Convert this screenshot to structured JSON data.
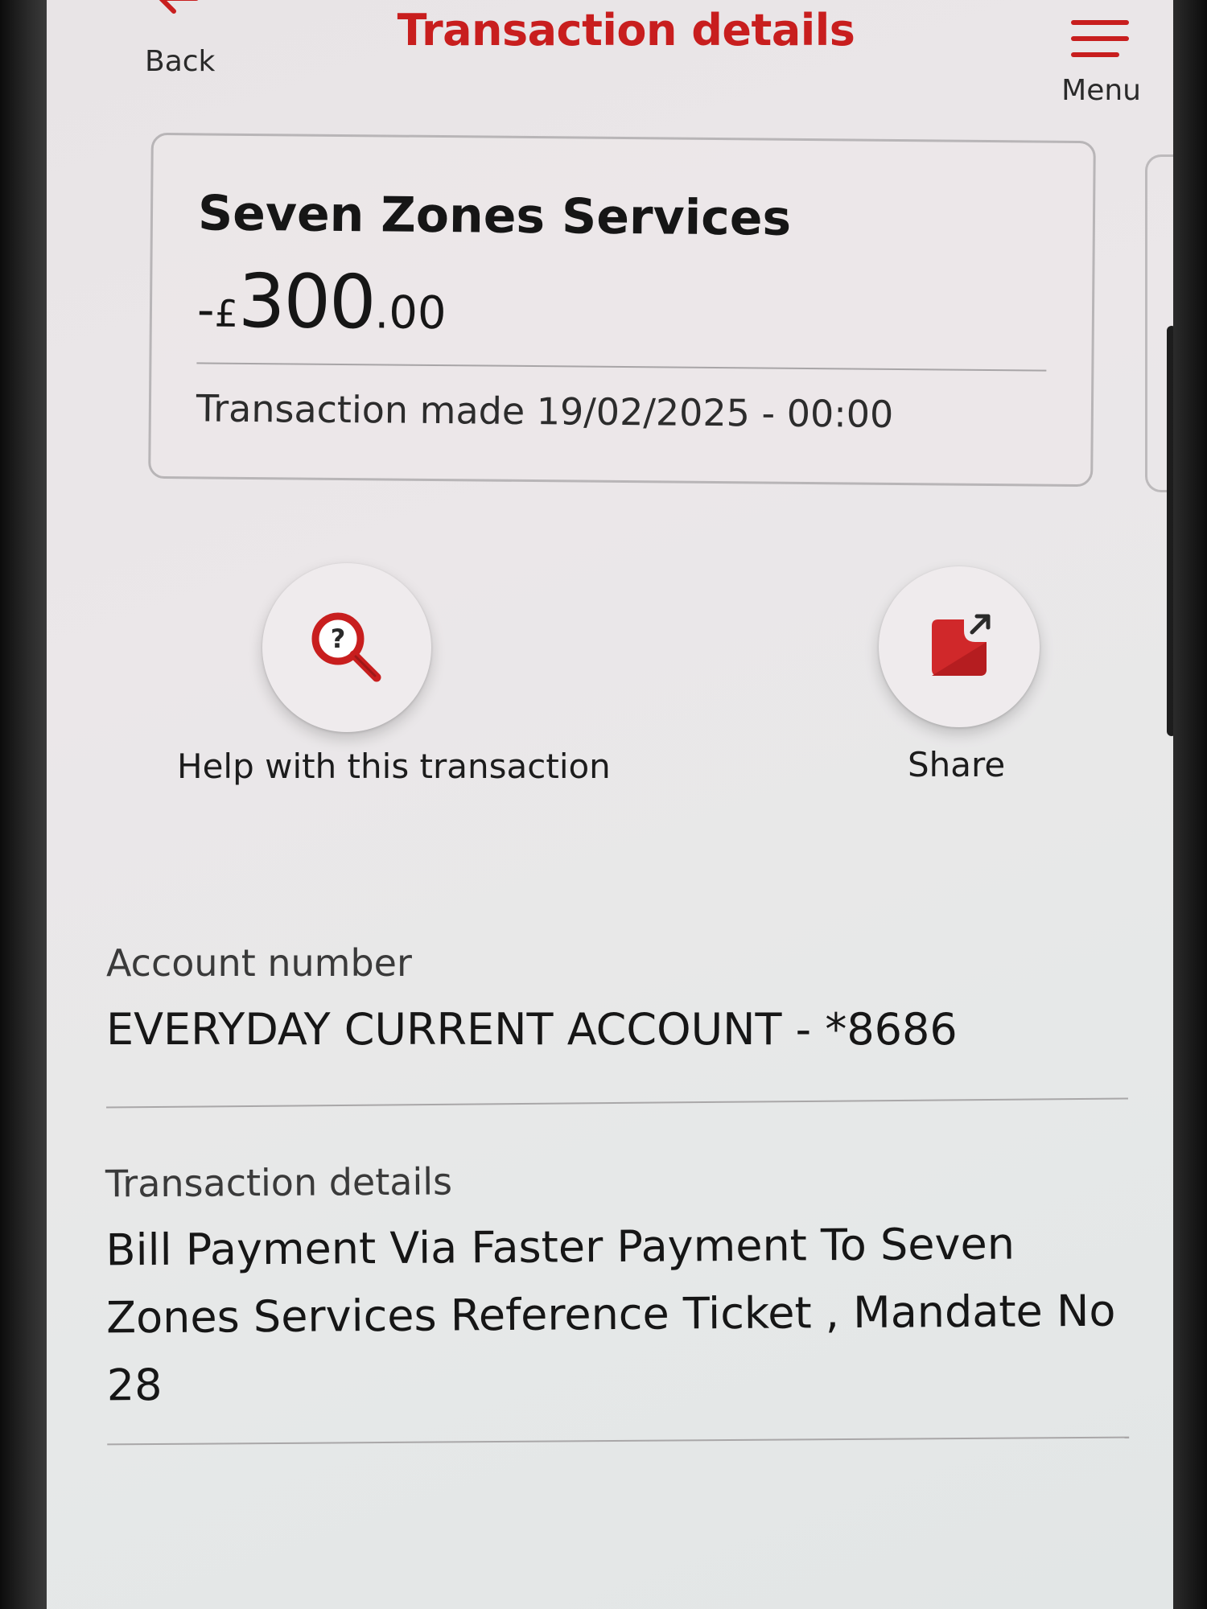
{
  "header": {
    "back_label": "Back",
    "title": "Transaction details",
    "menu_label": "Menu"
  },
  "summary": {
    "payee": "Seven Zones Services",
    "amount": {
      "sign": "-",
      "currency": "£",
      "whole": "300",
      "decimal": ".00"
    },
    "date_text": "Transaction made 19/02/2025 - 00:00"
  },
  "actions": [
    {
      "label": "Help with this transaction",
      "icon": "magnifier-question-icon"
    },
    {
      "label": "Share",
      "icon": "share-icon"
    }
  ],
  "fields": [
    {
      "label": "Account number",
      "value": "EVERYDAY CURRENT ACCOUNT - *8686"
    },
    {
      "label": "Transaction details",
      "value": "Bill Payment Via Faster Payment To Seven Zones Services Reference Ticket , Mandate No 28"
    }
  ],
  "colors": {
    "brand_red": "#c81e1e",
    "text_dark": "#161616",
    "screen_bg": "#e8e5e7"
  }
}
